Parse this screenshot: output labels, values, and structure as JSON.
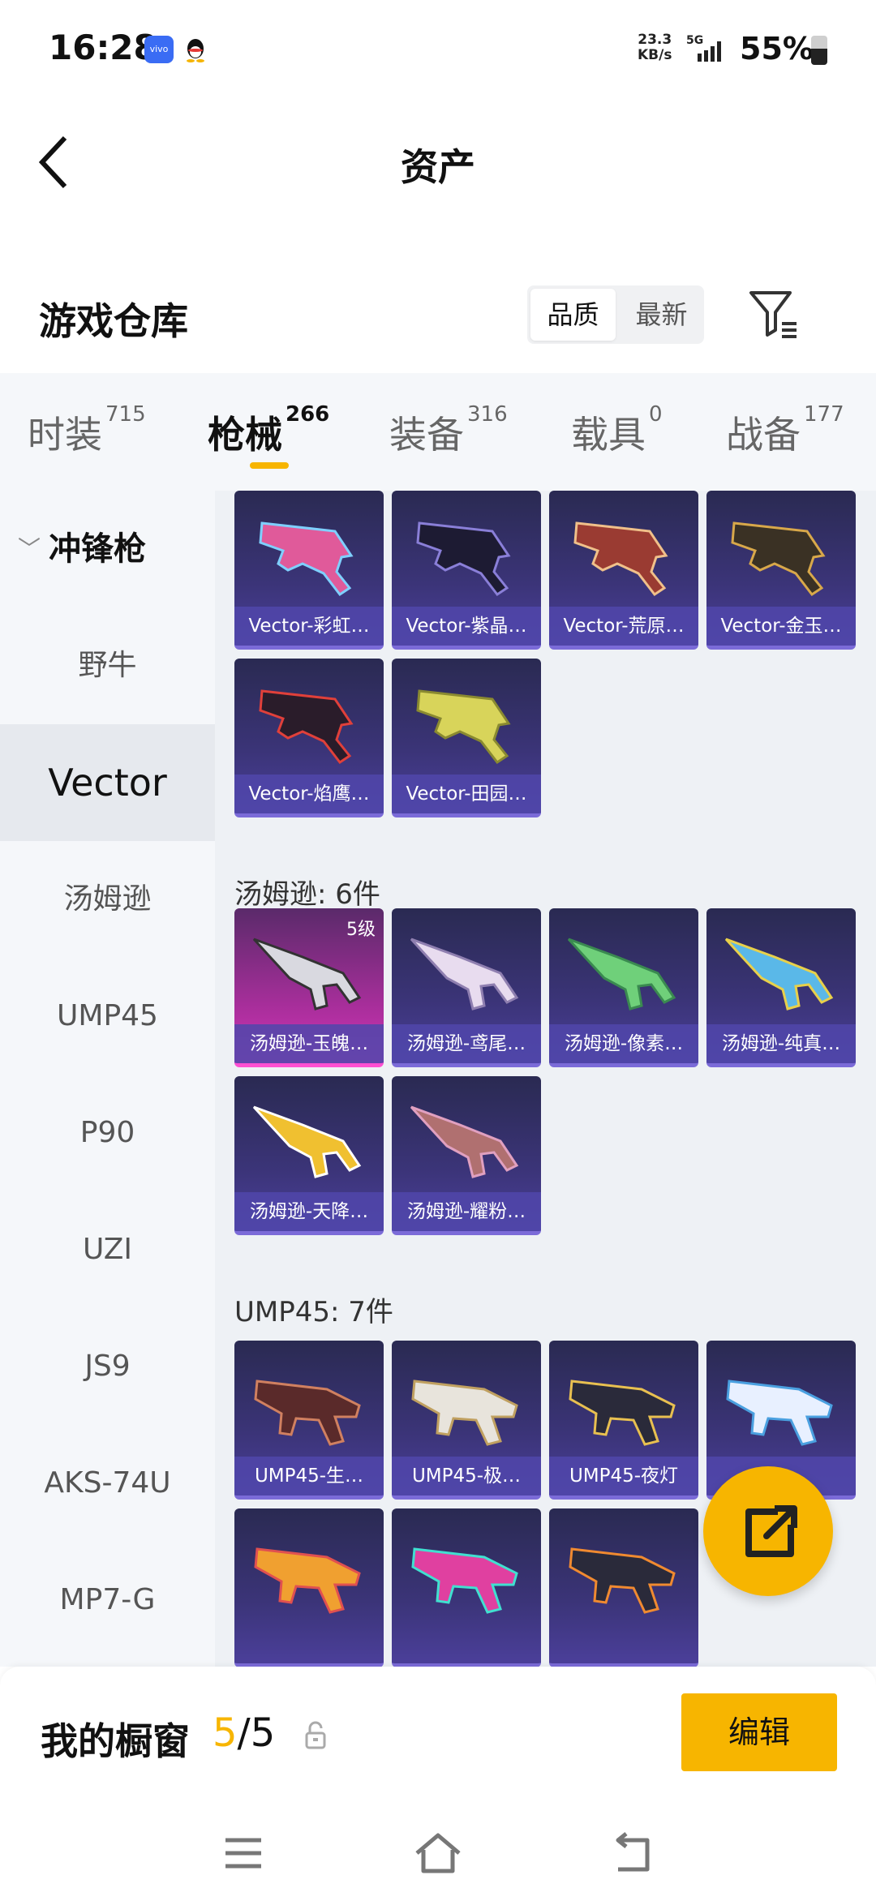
{
  "status": {
    "time": "16:28",
    "net_speed": "23.3",
    "net_unit": "KB/s",
    "network": "5G",
    "battery": "55%"
  },
  "header": {
    "title": "资产"
  },
  "warehouse": {
    "title": "游戏仓库",
    "sort_quality": "品质",
    "sort_newest": "最新"
  },
  "tabs": [
    {
      "label": "时装",
      "count": "715"
    },
    {
      "label": "枪械",
      "count": "266"
    },
    {
      "label": "装备",
      "count": "316"
    },
    {
      "label": "载具",
      "count": "0"
    },
    {
      "label": "战备",
      "count": "177"
    }
  ],
  "sidebar": {
    "group": "冲锋枪",
    "items": [
      "野牛",
      "Vector",
      "汤姆逊",
      "UMP45",
      "P90",
      "UZI",
      "JS9",
      "AKS-74U",
      "MP7-G"
    ]
  },
  "sections": {
    "vector": [
      "Vector-彩虹…",
      "Vector-紫晶…",
      "Vector-荒原…",
      "Vector-金玉…",
      "Vector-焰鹰…",
      "Vector-田园…"
    ],
    "thompson_label": "汤姆逊: 6件",
    "thompson": [
      "汤姆逊-玉魄…",
      "汤姆逊-鸢尾…",
      "汤姆逊-像素…",
      "汤姆逊-纯真…",
      "汤姆逊-天降…",
      "汤姆逊-耀粉…"
    ],
    "thompson_level": "5级",
    "ump_label": "UMP45: 7件",
    "ump": [
      "UMP45-生…",
      "UMP45-极…",
      "UMP45-夜灯",
      ""
    ]
  },
  "bottom": {
    "showcase_label": "我的橱窗",
    "current": "5",
    "total": "/5",
    "edit_label": "编辑"
  },
  "colors": {
    "accent": "#f7b500",
    "card": "#3b3478"
  }
}
